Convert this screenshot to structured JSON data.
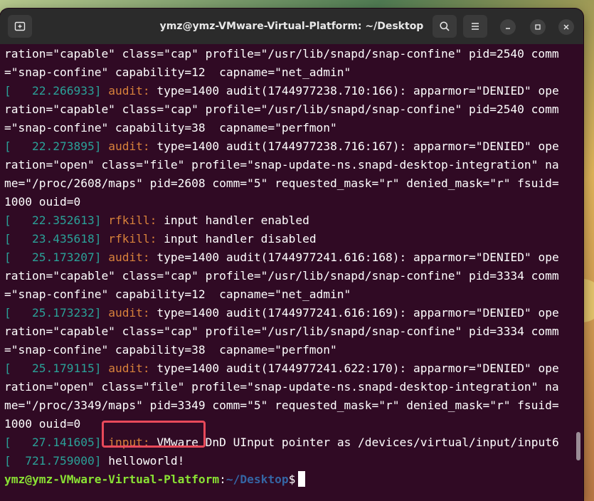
{
  "window": {
    "title": "ymz@ymz-VMware-Virtual-Platform: ~/Desktop"
  },
  "icons": {
    "new_tab": "new-tab-icon",
    "search": "search-icon",
    "menu": "hamburger-menu-icon",
    "minimize": "minimize-icon",
    "maximize": "maximize-icon",
    "close": "close-icon"
  },
  "colors": {
    "terminal_bg": "#300a24",
    "timestamp": "#2aa198",
    "source": "#d9823b",
    "prompt_user": "#8ae234",
    "prompt_path": "#3465a4",
    "highlight_box": "#e8495a"
  },
  "terminal": {
    "lines": [
      {
        "text": "ration=\"capable\" class=\"cap\" profile=\"/usr/lib/snapd/snap-confine\" pid=2540 comm"
      },
      {
        "text": "=\"snap-confine\" capability=12  capname=\"net_admin\""
      },
      {
        "ts": "[   22.266933]",
        "src": "audit:",
        "text": " type=1400 audit(1744977238.710:166): apparmor=\"DENIED\" ope"
      },
      {
        "text": "ration=\"capable\" class=\"cap\" profile=\"/usr/lib/snapd/snap-confine\" pid=2540 comm"
      },
      {
        "text": "=\"snap-confine\" capability=38  capname=\"perfmon\""
      },
      {
        "ts": "[   22.273895]",
        "src": "audit:",
        "text": " type=1400 audit(1744977238.716:167): apparmor=\"DENIED\" ope"
      },
      {
        "text": "ration=\"open\" class=\"file\" profile=\"snap-update-ns.snapd-desktop-integration\" na"
      },
      {
        "text": "me=\"/proc/2608/maps\" pid=2608 comm=\"5\" requested_mask=\"r\" denied_mask=\"r\" fsuid="
      },
      {
        "text": "1000 ouid=0"
      },
      {
        "ts": "[   22.352613]",
        "src": "rfkill:",
        "text": " input handler enabled"
      },
      {
        "ts": "[   23.435618]",
        "src": "rfkill:",
        "text": " input handler disabled"
      },
      {
        "ts": "[   25.173207]",
        "src": "audit:",
        "text": " type=1400 audit(1744977241.616:168): apparmor=\"DENIED\" ope"
      },
      {
        "text": "ration=\"capable\" class=\"cap\" profile=\"/usr/lib/snapd/snap-confine\" pid=3334 comm"
      },
      {
        "text": "=\"snap-confine\" capability=12  capname=\"net_admin\""
      },
      {
        "ts": "[   25.173232]",
        "src": "audit:",
        "text": " type=1400 audit(1744977241.616:169): apparmor=\"DENIED\" ope"
      },
      {
        "text": "ration=\"capable\" class=\"cap\" profile=\"/usr/lib/snapd/snap-confine\" pid=3334 comm"
      },
      {
        "text": "=\"snap-confine\" capability=38  capname=\"perfmon\""
      },
      {
        "ts": "[   25.179115]",
        "src": "audit:",
        "text": " type=1400 audit(1744977241.622:170): apparmor=\"DENIED\" ope"
      },
      {
        "text": "ration=\"open\" class=\"file\" profile=\"snap-update-ns.snapd-desktop-integration\" na"
      },
      {
        "text": "me=\"/proc/3349/maps\" pid=3349 comm=\"5\" requested_mask=\"r\" denied_mask=\"r\" fsuid="
      },
      {
        "text": "1000 ouid=0"
      },
      {
        "ts": "[   27.141605]",
        "src": "input:",
        "text": " VMware DnD UInput pointer as /devices/virtual/input/input6"
      },
      {
        "ts": "[  721.759000]",
        "text": " helloworld!"
      }
    ],
    "prompt": {
      "user_host": "ymz@ymz-VMware-Virtual-Platform",
      "colon": ":",
      "path": "~/Desktop",
      "symbol": "$"
    }
  }
}
